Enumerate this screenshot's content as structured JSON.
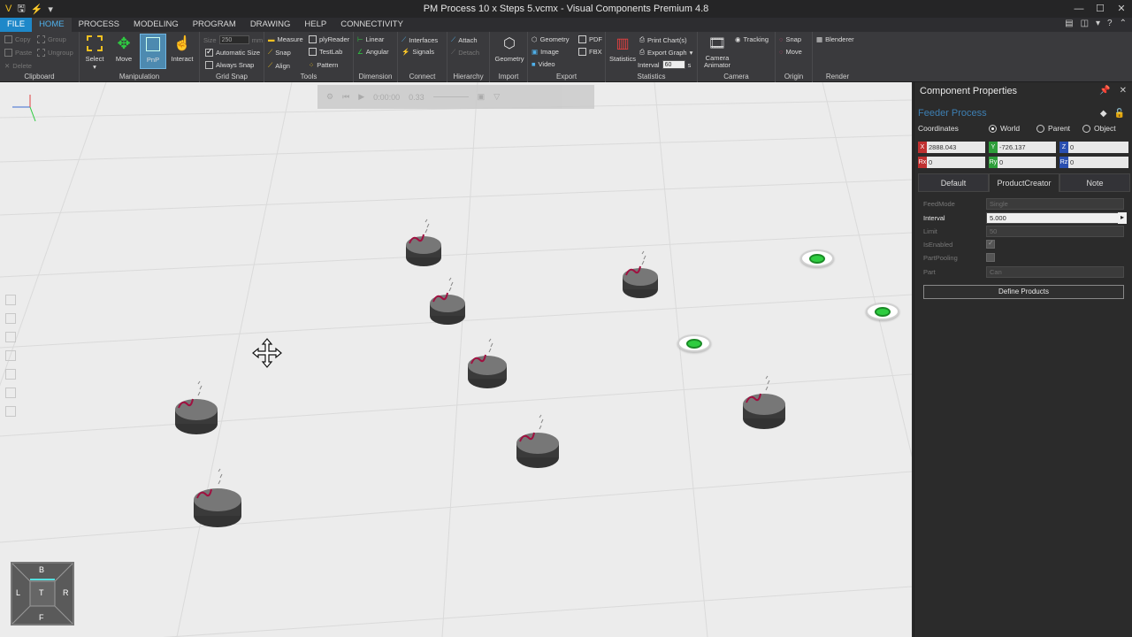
{
  "window": {
    "title": "PM Process 10 x Steps 5.vcmx - Visual Components Premium 4.8",
    "controls": [
      "—",
      "☐",
      "✕"
    ]
  },
  "menu_tabs": [
    {
      "label": "FILE"
    },
    {
      "label": "HOME"
    },
    {
      "label": "PROCESS"
    },
    {
      "label": "MODELING"
    },
    {
      "label": "PROGRAM"
    },
    {
      "label": "DRAWING"
    },
    {
      "label": "HELP"
    },
    {
      "label": "CONNECTIVITY"
    }
  ],
  "ribbon": {
    "clipboard": {
      "label": "Clipboard",
      "copy": "Copy",
      "paste": "Paste",
      "delete": "Delete",
      "group": "Group",
      "ungroup": "Ungroup"
    },
    "manipulation": {
      "label": "Manipulation",
      "select": "Select",
      "move": "Move",
      "pnp": "PnP",
      "interact": "Interact"
    },
    "grid_snap": {
      "label": "Grid Snap",
      "size_label": "Size",
      "size_value": "250",
      "size_unit": "mm",
      "automatic_size": "Automatic Size",
      "always_snap": "Always Snap"
    },
    "tools": {
      "label": "Tools",
      "measure": "Measure",
      "snap": "Snap",
      "align": "Align",
      "plyreader": "plyReader",
      "testlab": "TestLab",
      "pattern": "Pattern"
    },
    "dimension": {
      "label": "Dimension",
      "linear": "Linear",
      "angular": "Angular"
    },
    "connect": {
      "label": "Connect",
      "interfaces": "Interfaces",
      "signals": "Signals"
    },
    "hierarchy": {
      "label": "Hierarchy",
      "attach": "Attach",
      "detach": "Detach"
    },
    "import": {
      "label": "Import",
      "geometry": "Geometry"
    },
    "export": {
      "label": "Export",
      "geometry": "Geometry",
      "image": "Image",
      "video": "Video",
      "pdf": "PDF",
      "fbx": "FBX"
    },
    "statistics": {
      "label": "Statistics",
      "statistics": "Statistics",
      "print_charts": "Print Chart(s)",
      "export_graph": "Export Graph",
      "interval_label": "Interval",
      "interval_value": "60",
      "interval_unit": "s"
    },
    "camera": {
      "label": "Camera",
      "camera_animator": "Camera Animator",
      "tracking": "Tracking"
    },
    "origin": {
      "label": "Origin",
      "snap": "Snap",
      "move": "Move"
    },
    "render": {
      "label": "Render",
      "blenderer": "Blenderer"
    }
  },
  "viewport": {
    "sim_time": "0:00:00",
    "sim_speed": "0.33",
    "navcube": {
      "back": "B",
      "left": "L",
      "top": "T",
      "right": "R",
      "front": "F"
    }
  },
  "panel": {
    "title": "Component Properties",
    "component_name": "Feeder Process",
    "coordinates_label": "Coordinates",
    "coord_options": [
      {
        "label": "World",
        "selected": true
      },
      {
        "label": "Parent",
        "selected": false
      },
      {
        "label": "Object",
        "selected": false
      }
    ],
    "position": {
      "x": "2888.043",
      "y": "-726.137",
      "z": "0",
      "rx": "0",
      "ry": "0",
      "rz": "0"
    },
    "tabs": [
      {
        "label": "Default",
        "active": false
      },
      {
        "label": "ProductCreator",
        "active": true
      },
      {
        "label": "Note",
        "active": false
      }
    ],
    "properties": [
      {
        "label": "FeedMode",
        "value": "Single",
        "enabled": false
      },
      {
        "label": "Interval",
        "value": "5.000",
        "enabled": true
      },
      {
        "label": "Limit",
        "value": "50",
        "enabled": false
      },
      {
        "label": "IsEnabled",
        "value": "",
        "enabled": false
      },
      {
        "label": "PartPooling",
        "value": "",
        "enabled": false
      },
      {
        "label": "Part",
        "value": "Can",
        "enabled": false
      }
    ],
    "define_products": "Define Products"
  }
}
